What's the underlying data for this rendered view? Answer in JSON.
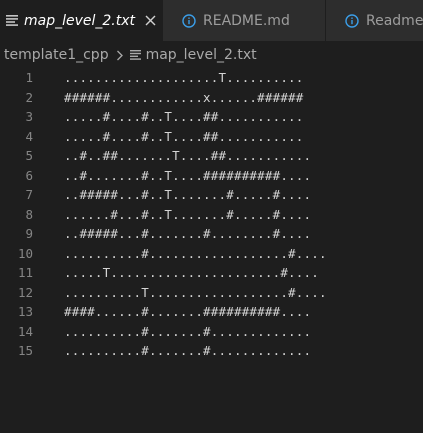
{
  "tabs": [
    {
      "label": "map_level_2.txt",
      "icon": "lines-icon",
      "active": true,
      "closable": true
    },
    {
      "label": "README.md",
      "icon": "info-icon",
      "active": false
    },
    {
      "label": "Readme",
      "icon": "info-icon",
      "active": false
    }
  ],
  "breadcrumb": {
    "folder": "template1_cpp",
    "file": "map_level_2.txt"
  },
  "editor": {
    "lines": [
      {
        "num": "1",
        "text": "....................T.........."
      },
      {
        "num": "2",
        "text": "######............x......######"
      },
      {
        "num": "3",
        "text": ".....#....#..T....##..........."
      },
      {
        "num": "4",
        "text": ".....#....#..T....##..........."
      },
      {
        "num": "5",
        "text": "..#..##.......T....##..........."
      },
      {
        "num": "6",
        "text": "..#.......#..T....##########...."
      },
      {
        "num": "7",
        "text": "..#####...#..T.......#.....#...."
      },
      {
        "num": "8",
        "text": "......#...#..T.......#.....#...."
      },
      {
        "num": "9",
        "text": "..#####...#.......#........#...."
      },
      {
        "num": "10",
        "text": "..........#..................#...."
      },
      {
        "num": "11",
        "text": ".....T......................#...."
      },
      {
        "num": "12",
        "text": "..........T..................#...."
      },
      {
        "num": "13",
        "text": "####......#.......##########...."
      },
      {
        "num": "14",
        "text": "..........#.......#............."
      },
      {
        "num": "15",
        "text": "..........#.......#............."
      }
    ]
  },
  "colors": {
    "background": "#1e1e1e",
    "tabbar": "#252526",
    "inactive_tab": "#2d2d2d",
    "text": "#d4d4d4",
    "line_number": "#858585",
    "info_icon": "#3b9ee8"
  }
}
